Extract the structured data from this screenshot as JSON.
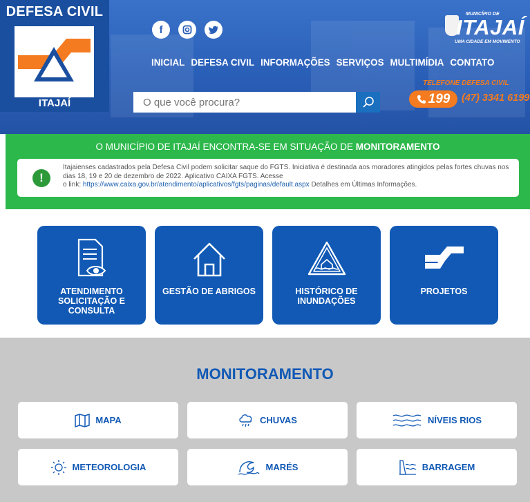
{
  "header": {
    "logo_title": "DEFESA CIVIL",
    "logo_subtitle": "ITAJAÍ",
    "social": [
      "facebook-icon",
      "instagram-icon",
      "twitter-icon"
    ],
    "nav": [
      "INICIAL",
      "DEFESA CIVIL",
      "INFORMAÇÕES",
      "SERVIÇOS",
      "MULTIMÍDIA",
      "CONTATO"
    ],
    "search_placeholder": "O que você procura?",
    "brand": {
      "municipio": "MUNICÍPIO DE",
      "name": "ITAJAÍ",
      "tagline": "UMA CIDADE EM MOVIMENTO"
    },
    "phone_label": "TELEFONE DEFESA CIVIL",
    "phone_emergency": "199",
    "phone_number": "(47) 3341 6199",
    "accent_color": "#f47b20"
  },
  "alert": {
    "title_prefix": "O MUNICÍPIO DE ITAJAÍ ENCONTRA-SE EM SITUAÇÃO DE ",
    "title_status": "MONITORAMENTO",
    "text": "Itajaienses cadastrados pela Defesa Civil podem solicitar saque do FGTS. Iniciativa é destinada aos moradores atingidos pelas fortes chuvas nos dias 18, 19 e 20 de dezembro de 2022. Aplicativo CAIXA FGTS. Acesse",
    "link_prefix": "o link: ",
    "link": "https://www.caixa.gov.br/atendimento/aplicativos/fgts/paginas/default.aspx",
    "link_suffix": " Detalhes em Últimas Informações.",
    "band_color": "#2db84b"
  },
  "tiles": [
    {
      "label": "ATENDIMENTO SOLICITAÇÃO E CONSULTA",
      "icon": "document-eye-icon"
    },
    {
      "label": "GESTÃO DE ABRIGOS",
      "icon": "house-icon"
    },
    {
      "label": "HISTÓRICO DE INUNDAÇÕES",
      "icon": "flood-warning-icon"
    },
    {
      "label": "PROJETOS",
      "icon": "defesa-civil-logo-icon"
    }
  ],
  "monitoring": {
    "title": "MONITORAMENTO",
    "items": [
      {
        "label": "MAPA",
        "icon": "map-icon"
      },
      {
        "label": "CHUVAS",
        "icon": "rain-cloud-icon"
      },
      {
        "label": "NÍVEIS RIOS",
        "icon": "river-waves-icon"
      },
      {
        "label": "METEOROLOGIA",
        "icon": "sun-icon"
      },
      {
        "label": "MARÉS",
        "icon": "tide-wave-icon"
      },
      {
        "label": "BARRAGEM",
        "icon": "dam-icon"
      }
    ]
  }
}
